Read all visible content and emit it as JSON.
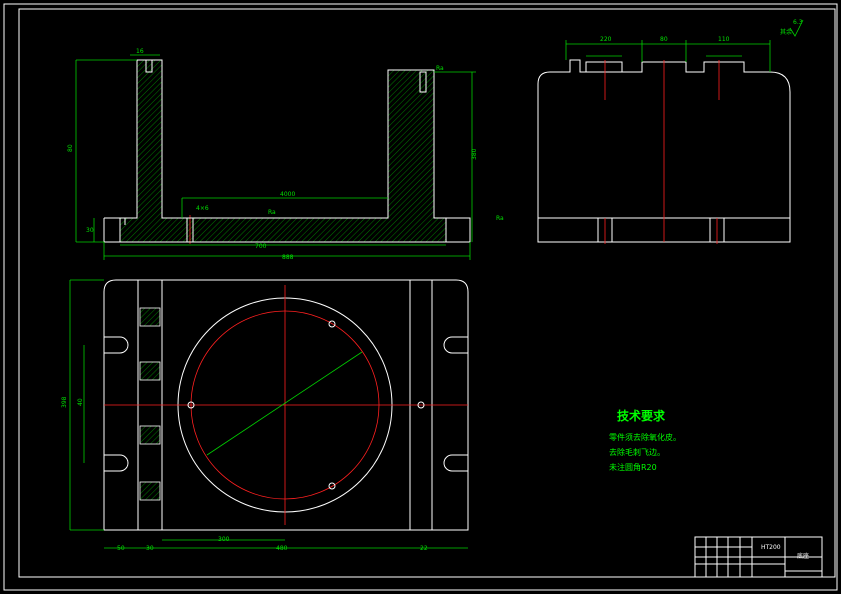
{
  "colors": {
    "background": "#000000",
    "outline": "#ffffff",
    "dimension": "#00d000",
    "centerline": "#ff2020",
    "notes": "#00ff00"
  },
  "dimensions": {
    "front_height_left": "80",
    "front_height_right": "380",
    "front_height_base": "30",
    "front_inner_width": "4000",
    "front_total_width": "700",
    "front_overall_width": "888",
    "front_slot": "16",
    "front_label_left": "4×6",
    "front_surface_mark": "Ra",
    "side_width_a": "220",
    "side_width_b": "80",
    "side_width_c": "110",
    "plan_height": "398",
    "plan_inner_height": "40",
    "plan_bottom_a": "50",
    "plan_bottom_b": "30",
    "plan_bottom_c": "300",
    "plan_bottom_d": "480",
    "plan_bottom_e": "22"
  },
  "surface_finish": {
    "label": "其余",
    "value": "6.3"
  },
  "tech_notes": {
    "title": "技术要求",
    "lines": [
      "零件须去除氧化皮。",
      "去除毛刺飞边。",
      "未注圆角R20"
    ]
  },
  "title_block": {
    "name": "底座",
    "material": "HT200"
  }
}
